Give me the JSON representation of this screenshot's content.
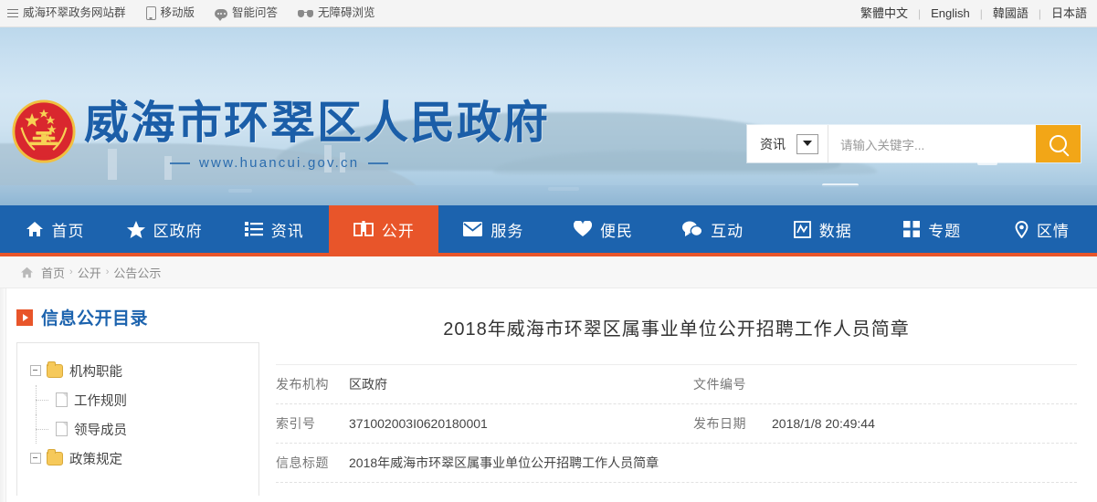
{
  "topbar": {
    "site_group": "威海环翠政务网站群",
    "items": [
      {
        "label": "移动版",
        "icon": "phone-icon"
      },
      {
        "label": "智能问答",
        "icon": "chat-bubble-icon"
      },
      {
        "label": "无障碍浏览",
        "icon": "glasses-icon"
      }
    ],
    "languages": [
      "繁體中文",
      "English",
      "韓國語",
      "日本語"
    ],
    "separator": "|"
  },
  "banner": {
    "site_title": "威海市环翠区人民政府",
    "site_url": "www.huancui.gov.cn",
    "emblem": "national-emblem-icon"
  },
  "search": {
    "category": "资讯",
    "placeholder": "请输入关键字...",
    "value": "",
    "button_icon": "search-icon"
  },
  "nav": {
    "items": [
      {
        "label": "首页",
        "icon": "home-icon",
        "active": false
      },
      {
        "label": "区政府",
        "icon": "star-icon",
        "active": false
      },
      {
        "label": "资讯",
        "icon": "list-icon",
        "active": false
      },
      {
        "label": "公开",
        "icon": "book-icon",
        "active": true
      },
      {
        "label": "服务",
        "icon": "envelope-icon",
        "active": false
      },
      {
        "label": "便民",
        "icon": "heart-icon",
        "active": false
      },
      {
        "label": "互动",
        "icon": "chat-icon",
        "active": false
      },
      {
        "label": "数据",
        "icon": "chart-icon",
        "active": false
      },
      {
        "label": "专题",
        "icon": "grid-icon",
        "active": false
      },
      {
        "label": "区情",
        "icon": "location-pin-icon",
        "active": false
      }
    ]
  },
  "breadcrumb": {
    "home_icon": "home-icon",
    "items": [
      "首页",
      "公开",
      "公告公示"
    ],
    "separator": "›"
  },
  "sidebar": {
    "title": "信息公开目录",
    "tree": [
      {
        "label": "机构职能",
        "type": "folder",
        "level": 0,
        "expanded": true
      },
      {
        "label": "工作规则",
        "type": "doc",
        "level": 1
      },
      {
        "label": "领导成员",
        "type": "doc",
        "level": 1
      },
      {
        "label": "政策规定",
        "type": "folder",
        "level": 0,
        "expanded": true
      }
    ]
  },
  "article": {
    "title": "2018年威海市环翠区属事业单位公开招聘工作人员简章",
    "meta": [
      {
        "label": "发布机构",
        "value": "区政府",
        "label2": "文件编号",
        "value2": ""
      },
      {
        "label": "索引号",
        "value": "371002003I0620180001",
        "label2": "发布日期",
        "value2": "2018/1/8 20:49:44"
      },
      {
        "label": "信息标题",
        "value": "2018年威海市环翠区属事业单位公开招聘工作人员简章",
        "label2": "",
        "value2": ""
      }
    ]
  },
  "colors": {
    "nav_blue": "#1c63ae",
    "accent_orange": "#e8552a",
    "search_orange": "#f2a617",
    "title_blue": "#1b5ea8"
  }
}
